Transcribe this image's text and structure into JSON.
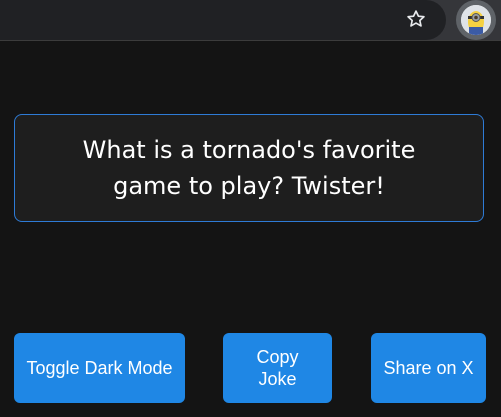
{
  "browser": {
    "bookmark_icon": "star-outline-icon",
    "profile_icon": "minion-avatar-icon"
  },
  "joke": {
    "text": "What is a tornado's favorite game to play? Twister!"
  },
  "buttons": {
    "toggle_dark_mode": "Toggle Dark Mode",
    "copy_joke": "Copy Joke",
    "share_on_x": "Share on X"
  },
  "colors": {
    "background": "#141414",
    "card_border": "#2e7bd6",
    "button": "#1f87e5",
    "text": "#ffffff"
  }
}
